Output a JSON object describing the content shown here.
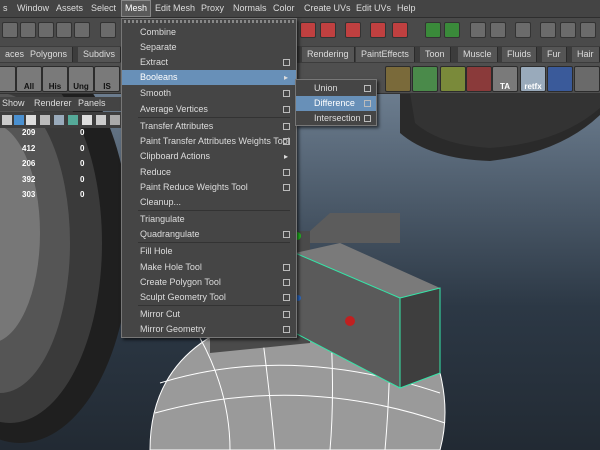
{
  "menubar": {
    "items": [
      "s",
      "Window",
      "Assets",
      "Select",
      "Mesh",
      "Edit Mesh",
      "Proxy",
      "Normals",
      "Color",
      "Create UVs",
      "Edit UVs",
      "Help"
    ],
    "active": "Mesh"
  },
  "shelf_tabs": [
    "aces",
    "Polygons",
    "Subdivs",
    "Rendering",
    "PaintEffects",
    "Toon",
    "Muscle",
    "Fluids",
    "Fur",
    "Hair"
  ],
  "shelf_icon_labels": [
    "All",
    "His",
    "Ung",
    "IS"
  ],
  "shelf_right_labels": [
    "TA",
    "retfx"
  ],
  "panel_menu": [
    "Show",
    "Renderer",
    "Panels"
  ],
  "num_table": {
    "rows": [
      {
        "a": "209",
        "b": "0"
      },
      {
        "a": "412",
        "b": "0"
      },
      {
        "a": "206",
        "b": "0"
      },
      {
        "a": "392",
        "b": "0"
      },
      {
        "a": "303",
        "b": "0"
      }
    ]
  },
  "mesh_menu": {
    "items": [
      {
        "label": "Combine",
        "option_box": false,
        "submenu": false
      },
      {
        "label": "Separate",
        "option_box": false,
        "submenu": false
      },
      {
        "label": "Extract",
        "option_box": true,
        "submenu": false
      },
      {
        "label": "Booleans",
        "option_box": false,
        "submenu": true,
        "highlighted": true
      },
      {
        "label": "Smooth",
        "option_box": true,
        "submenu": false
      },
      {
        "label": "Average Vertices",
        "option_box": true,
        "submenu": false
      },
      {
        "label": "Transfer Attributes",
        "option_box": true,
        "submenu": false
      },
      {
        "label": "Paint Transfer Attributes Weights Tool",
        "option_box": true,
        "submenu": false
      },
      {
        "label": "Clipboard Actions",
        "option_box": false,
        "submenu": true
      },
      {
        "label": "Reduce",
        "option_box": true,
        "submenu": false
      },
      {
        "label": "Paint Reduce Weights Tool",
        "option_box": true,
        "submenu": false
      },
      {
        "label": "Cleanup...",
        "option_box": false,
        "submenu": false
      },
      {
        "label": "Triangulate",
        "option_box": false,
        "submenu": false
      },
      {
        "label": "Quadrangulate",
        "option_box": true,
        "submenu": false
      },
      {
        "label": "Fill Hole",
        "option_box": false,
        "submenu": false
      },
      {
        "label": "Make Hole Tool",
        "option_box": true,
        "submenu": false
      },
      {
        "label": "Create Polygon Tool",
        "option_box": true,
        "submenu": false
      },
      {
        "label": "Sculpt Geometry Tool",
        "option_box": true,
        "submenu": false
      },
      {
        "label": "Mirror Cut",
        "option_box": true,
        "submenu": false
      },
      {
        "label": "Mirror Geometry",
        "option_box": true,
        "submenu": false
      }
    ]
  },
  "booleans_submenu": {
    "items": [
      {
        "label": "Union",
        "option_box": true,
        "highlighted": false
      },
      {
        "label": "Difference",
        "option_box": true,
        "highlighted": true
      },
      {
        "label": "Intersection",
        "option_box": true,
        "highlighted": false
      }
    ]
  },
  "colors": {
    "highlight": "#6890b8",
    "selection_edge": "#35e6a8",
    "wire": "#ffffff"
  }
}
